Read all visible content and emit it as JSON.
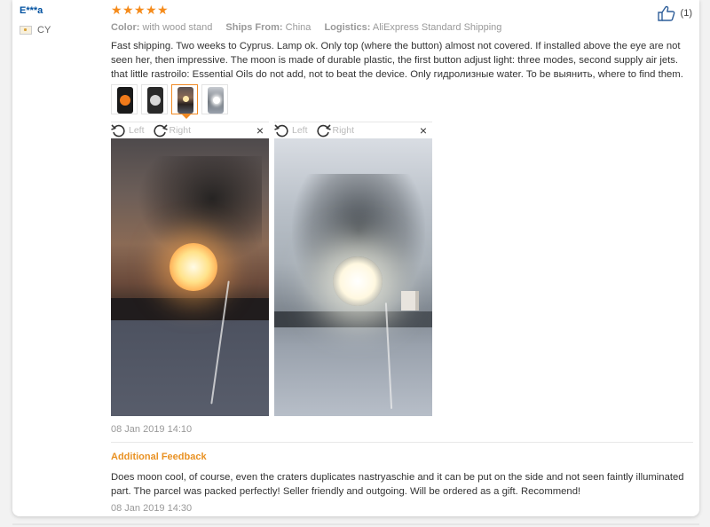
{
  "review": {
    "user": "E***a",
    "country": "CY",
    "rating": 5,
    "likes": "(1)",
    "color_label": "Color:",
    "color_value": "with wood stand",
    "ships_label": "Ships From:",
    "ships_value": "China",
    "logistics_label": "Logistics:",
    "logistics_value": "AliExpress Standard Shipping",
    "text": "Fast shipping. Two weeks to Cyprus. Lamp ok. Only top (where the button) almost not covered. If installed above the eye are not seen her, then impressive. The moon is made of durable plastic, the first button adjust light: three modes, second supply air jets. that little rastroilo: Essential Oils do not add, not to beat the device. Only гидролизные water. To be выянить, where to find them.",
    "date": "08 Jan 2019 14:10"
  },
  "viewer": {
    "left_label": "Left",
    "right_label": "Right",
    "close_symbol": "×"
  },
  "additional": {
    "title": "Additional Feedback",
    "text": "Does moon cool, of course, even the craters duplicates nastryaschie and it can be put on the side and not seen faintly illuminated part. The parcel was packed perfectly! Seller friendly and outgoing. Will be ordered as a gift. Recommend!",
    "date": "08 Jan 2019 14:30"
  },
  "colors": {
    "username": "#0051a0",
    "star": "#f58b1b",
    "accent": "#e99224"
  },
  "thumbnails": [
    {
      "name": "thumb-orange-moon",
      "active": false
    },
    {
      "name": "thumb-white-moon",
      "active": false
    },
    {
      "name": "thumb-sunset-photo",
      "active": true
    },
    {
      "name": "thumb-wall-photo",
      "active": false
    }
  ]
}
